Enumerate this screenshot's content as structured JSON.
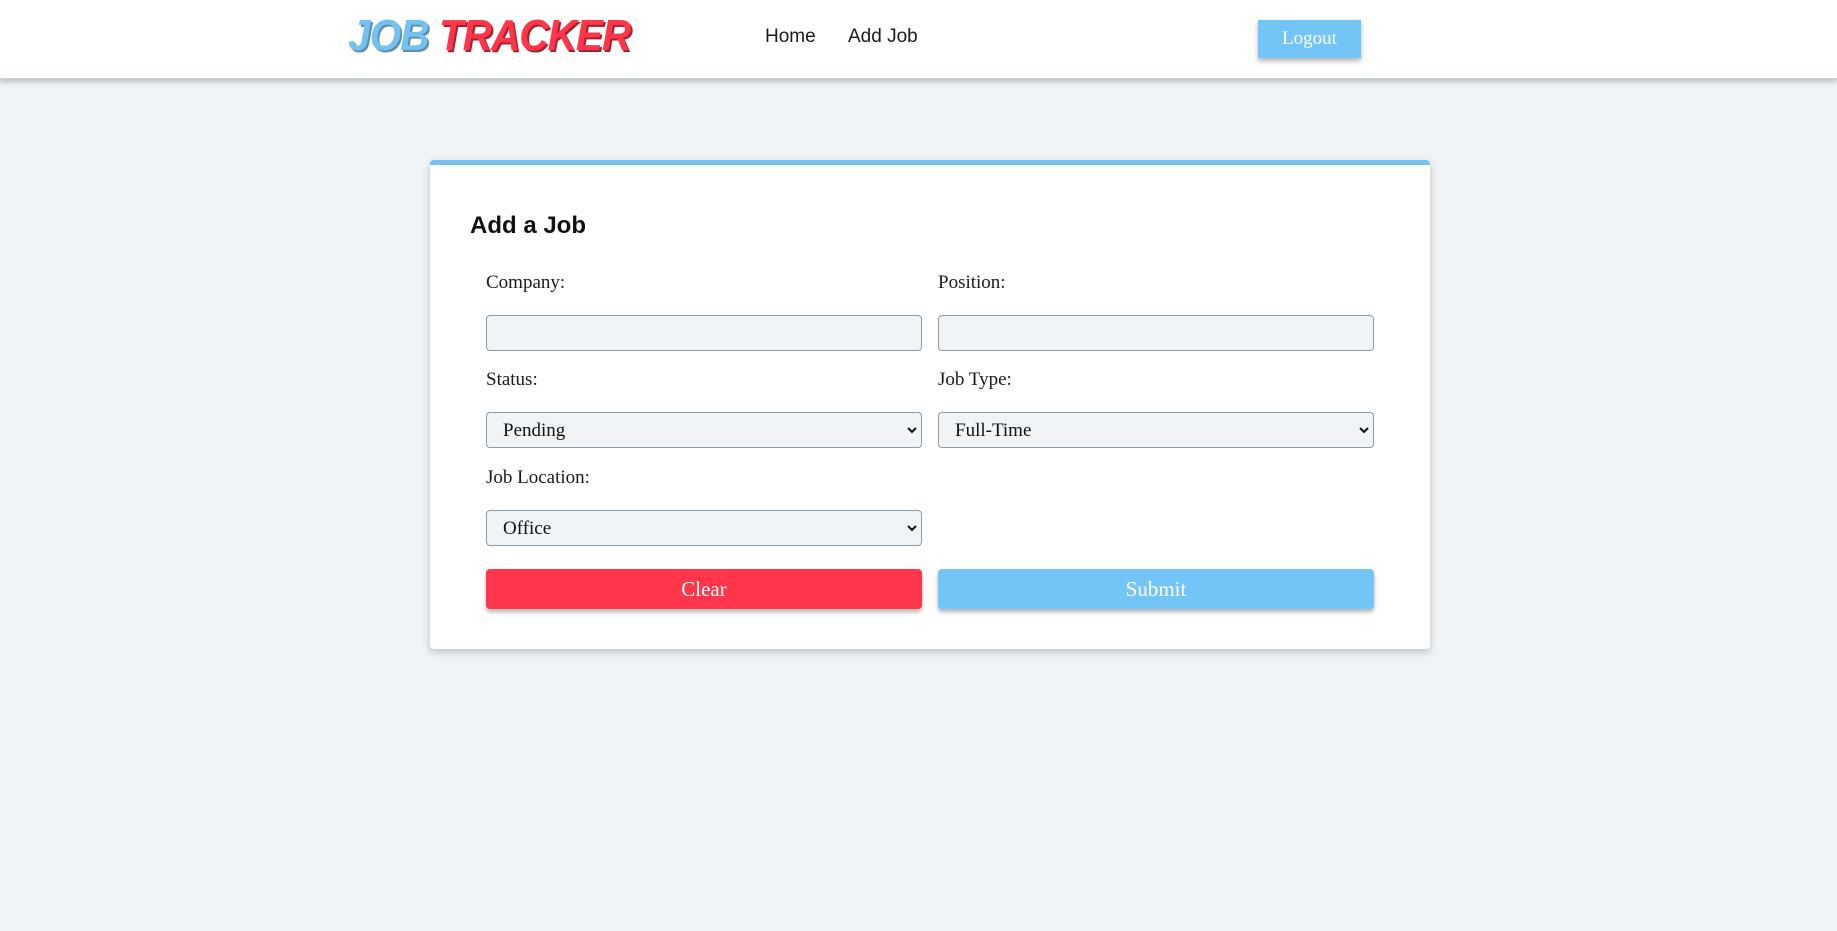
{
  "brand": {
    "logo_part1": "JOB",
    "logo_part2": "TRACKER",
    "color_primary": "#74c2f0",
    "color_accent": "#ff3549"
  },
  "nav": {
    "links": [
      {
        "label": "Home"
      },
      {
        "label": "Add Job"
      }
    ],
    "logout_label": "Logout"
  },
  "form": {
    "title": "Add a Job",
    "company": {
      "label": "Company:",
      "value": ""
    },
    "position": {
      "label": "Position:",
      "value": ""
    },
    "status": {
      "label": "Status:",
      "selected": "Pending"
    },
    "job_type": {
      "label": "Job Type:",
      "selected": "Full-Time"
    },
    "job_location": {
      "label": "Job Location:",
      "selected": "Office"
    },
    "clear_label": "Clear",
    "submit_label": "Submit",
    "clear_color": "#ff354b",
    "submit_color": "#74c5f7"
  }
}
